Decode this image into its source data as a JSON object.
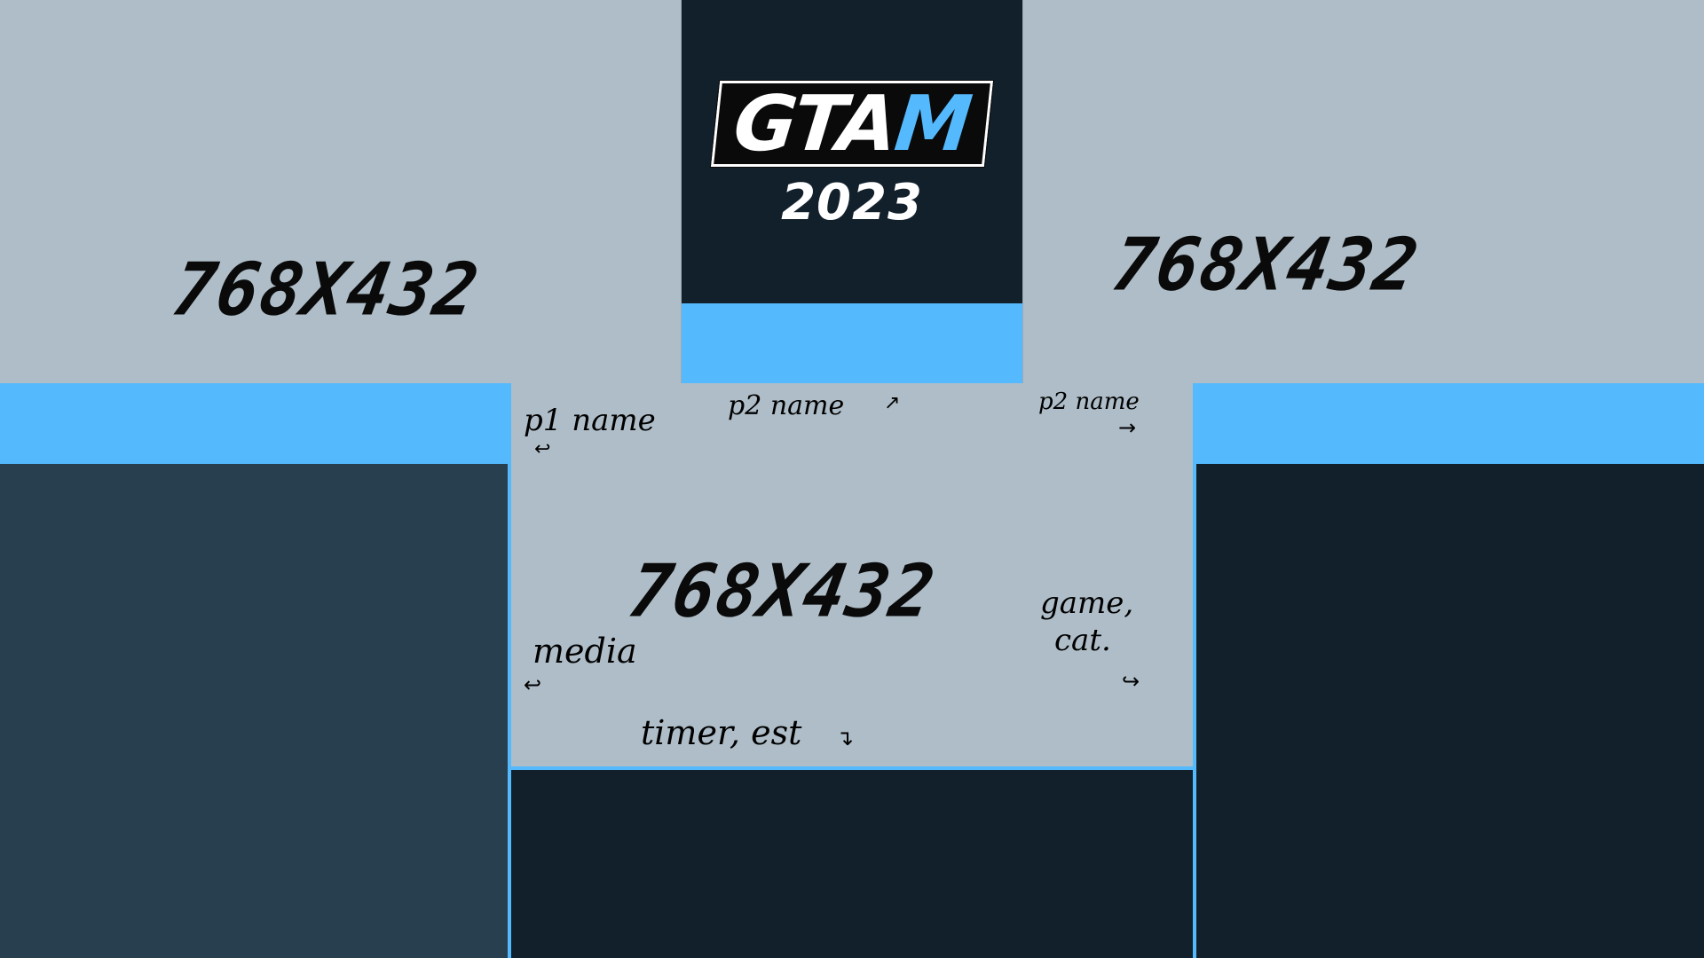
{
  "slots": {
    "top_left": "768X432",
    "top_right": "768X432",
    "center": "768X432"
  },
  "logo": {
    "text_white": "GTA",
    "text_blue": "M",
    "year": "2023"
  },
  "notes": {
    "p1_name": "p1 name",
    "p2_name_center": "p2 name",
    "p2_name_right": "p2 name",
    "media": "media",
    "game_cat_line1": "game,",
    "game_cat_line2": "cat.",
    "timer_est": "timer, est"
  },
  "colors": {
    "accent": "#54b9fd",
    "dark_navy": "#12202c",
    "slate": "#283f50",
    "slot_gray": "#aebdc7"
  }
}
